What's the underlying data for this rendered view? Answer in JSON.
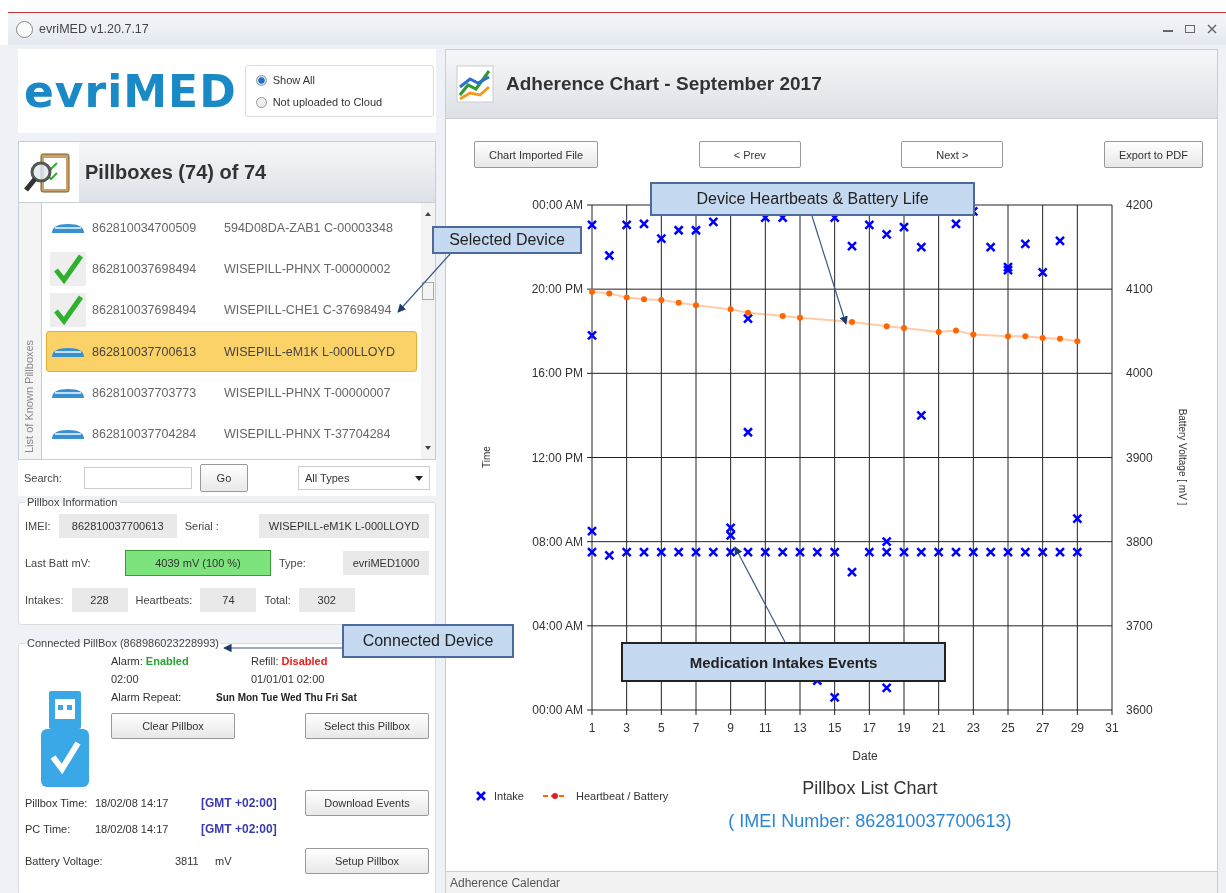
{
  "window": {
    "title": "evriMED v1.20.7.17"
  },
  "logo": "evriMED",
  "filter": [
    {
      "label": "Show All",
      "selected": true
    },
    {
      "label": "Not uploaded to Cloud",
      "selected": false
    }
  ],
  "pillboxes": {
    "title": "Pillboxes (74) of 74",
    "list_label": "List of Known Pillboxes",
    "rows": [
      {
        "kind": "device",
        "imei": "862810034700509",
        "serial": "594D08DA-ZAB1 C-00003348",
        "selected": false
      },
      {
        "kind": "check",
        "imei": "862810037698494",
        "serial": "WISEPILL-PHNX T-00000002",
        "selected": false
      },
      {
        "kind": "check",
        "imei": "862810037698494",
        "serial": "WISEPILL-CHE1 C-37698494",
        "selected": false
      },
      {
        "kind": "device",
        "imei": "862810037700613",
        "serial": "WISEPILL-eM1K L-000LLOYD",
        "selected": true
      },
      {
        "kind": "device",
        "imei": "862810037703773",
        "serial": "WISEPILL-PHNX T-00000007",
        "selected": false
      },
      {
        "kind": "device",
        "imei": "862810037704284",
        "serial": "WISEPILL-PHNX T-37704284",
        "selected": false
      }
    ]
  },
  "search": {
    "label": "Search:",
    "button": "Go",
    "type_filter": "All Types"
  },
  "pillbox_information": {
    "title": "Pillbox Information",
    "imei_label": "IMEI:",
    "imei": "862810037700613",
    "serial_label": "Serial :",
    "serial": "WISEPILL-eM1K L-000LLOYD",
    "batt_label": "Last Batt mV:",
    "batt": "4039 mV  (100 %)",
    "type_label": "Type:",
    "type": "evriMED1000",
    "intakes_label": "Intakes:",
    "intakes": "228",
    "heartbeats_label": "Heartbeats:",
    "heartbeats": "74",
    "total_label": "Total:",
    "total": "302"
  },
  "connected": {
    "title": "Connected PillBox  (868986023228993)",
    "alarm": {
      "label": "Alarm:",
      "value": "Enabled",
      "on": true
    },
    "refill": {
      "label": "Refill:",
      "value": "Disabled",
      "on": false
    },
    "alarm_time": "02:00",
    "refill_time": "01/01/01 02:00",
    "repeat_label": "Alarm Repeat:",
    "repeat_days": "Sun Mon Tue Wed Thu Fri Sat",
    "pillbox_time_label": "Pillbox Time:",
    "pillbox_time": "18/02/08 14:17",
    "pillbox_tz": "[GMT +02:00]",
    "pc_time_label": "PC Time:",
    "pc_time": "18/02/08 14:17",
    "pc_tz": "[GMT +02:00]",
    "battery_label": "Battery Voltage:",
    "battery": "3811",
    "battery_unit": "mV",
    "buttons": [
      "Clear Pillbox",
      "Select this Pillbox",
      "Download Events",
      "Setup Pillbox"
    ]
  },
  "chart_panel": {
    "title": "Adherence Chart - September 2017",
    "buttons": [
      "Chart Imported File",
      "< Prev",
      "Next >",
      "Export to PDF"
    ],
    "chart_data": {
      "type": "scatter",
      "grid": true,
      "xlabel": "Date",
      "ylabel": "Time",
      "y2label": "Battery  Voltage  [ mV ]",
      "xlim": [
        1,
        31
      ],
      "xticks": [
        1,
        3,
        5,
        7,
        9,
        11,
        13,
        15,
        17,
        19,
        21,
        23,
        25,
        27,
        29,
        31
      ],
      "ylim": [
        0,
        24
      ],
      "yticks": [
        {
          "value": 0,
          "label": "00:00 AM"
        },
        {
          "value": 4,
          "label": "04:00 AM"
        },
        {
          "value": 8,
          "label": "08:00 AM"
        },
        {
          "value": 12,
          "label": "12:00 PM"
        },
        {
          "value": 16,
          "label": "16:00 PM"
        },
        {
          "value": 20,
          "label": "20:00 PM"
        },
        {
          "value": 24,
          "label": "00:00 AM"
        }
      ],
      "y2lim": [
        3600,
        4200
      ],
      "y2ticks": [
        3600,
        3700,
        3800,
        3900,
        4000,
        4100,
        4200
      ],
      "series": [
        {
          "name": "Intake",
          "color": "#0000ff",
          "marker": "x",
          "x": [
            1,
            2,
            3,
            4,
            5,
            6,
            7,
            8,
            11,
            12,
            15,
            16,
            17,
            18,
            19,
            20,
            22,
            23,
            24,
            25,
            25,
            26,
            27,
            28,
            1,
            10,
            10,
            20,
            1,
            9,
            9,
            18,
            29,
            1,
            2,
            3,
            4,
            5,
            6,
            7,
            8,
            9,
            10,
            11,
            12,
            13,
            14,
            15,
            17,
            18,
            19,
            20,
            21,
            22,
            23,
            24,
            25,
            26,
            27,
            28,
            29,
            16,
            14,
            15,
            18
          ],
          "values": [
            23.05,
            21.6,
            23.05,
            23.1,
            22.4,
            22.8,
            22.8,
            23.2,
            23.4,
            23.4,
            23.4,
            22.05,
            23.05,
            22.6,
            22.95,
            22.0,
            23.1,
            23.7,
            22.0,
            21.05,
            20.9,
            22.15,
            20.8,
            22.3,
            17.8,
            18.6,
            13.2,
            14.0,
            8.5,
            8.65,
            8.3,
            8.0,
            9.1,
            7.5,
            7.35,
            7.5,
            7.5,
            7.5,
            7.5,
            7.5,
            7.5,
            7.5,
            7.5,
            7.5,
            7.5,
            7.5,
            7.5,
            7.5,
            7.5,
            7.5,
            7.5,
            7.5,
            7.5,
            7.5,
            7.5,
            7.5,
            7.5,
            7.5,
            7.5,
            7.5,
            7.5,
            6.55,
            1.4,
            0.6,
            1.05
          ]
        },
        {
          "name": "Heartbeat / Battery",
          "color": "#ff6600",
          "type": "line",
          "marker": "circle",
          "axis": "y2",
          "x": [
            1,
            2,
            3,
            4,
            5,
            6,
            7,
            9,
            10,
            12,
            13,
            16,
            18,
            19,
            21,
            22,
            23,
            25,
            26,
            27,
            28,
            29
          ],
          "values": [
            4097,
            4095,
            4090,
            4088,
            4087,
            4084,
            4081,
            4076,
            4072,
            4068,
            4066,
            4061,
            4056,
            4054,
            4049,
            4051,
            4046,
            4044,
            4044,
            4042,
            4041,
            4038
          ]
        }
      ]
    },
    "chart_title": "Pillbox List Chart",
    "subtitle": "( IMEI Number: 862810037700613)"
  },
  "callouts": [
    {
      "kind": "selected",
      "text": "Selected Device"
    },
    {
      "kind": "connected",
      "text": "Connected Device"
    },
    {
      "kind": "heartbeats",
      "text": "Device Heartbeats & Battery Life"
    },
    {
      "kind": "intakes",
      "text": "Medication Intakes Events"
    }
  ],
  "status_bar": "Adherence Calendar"
}
